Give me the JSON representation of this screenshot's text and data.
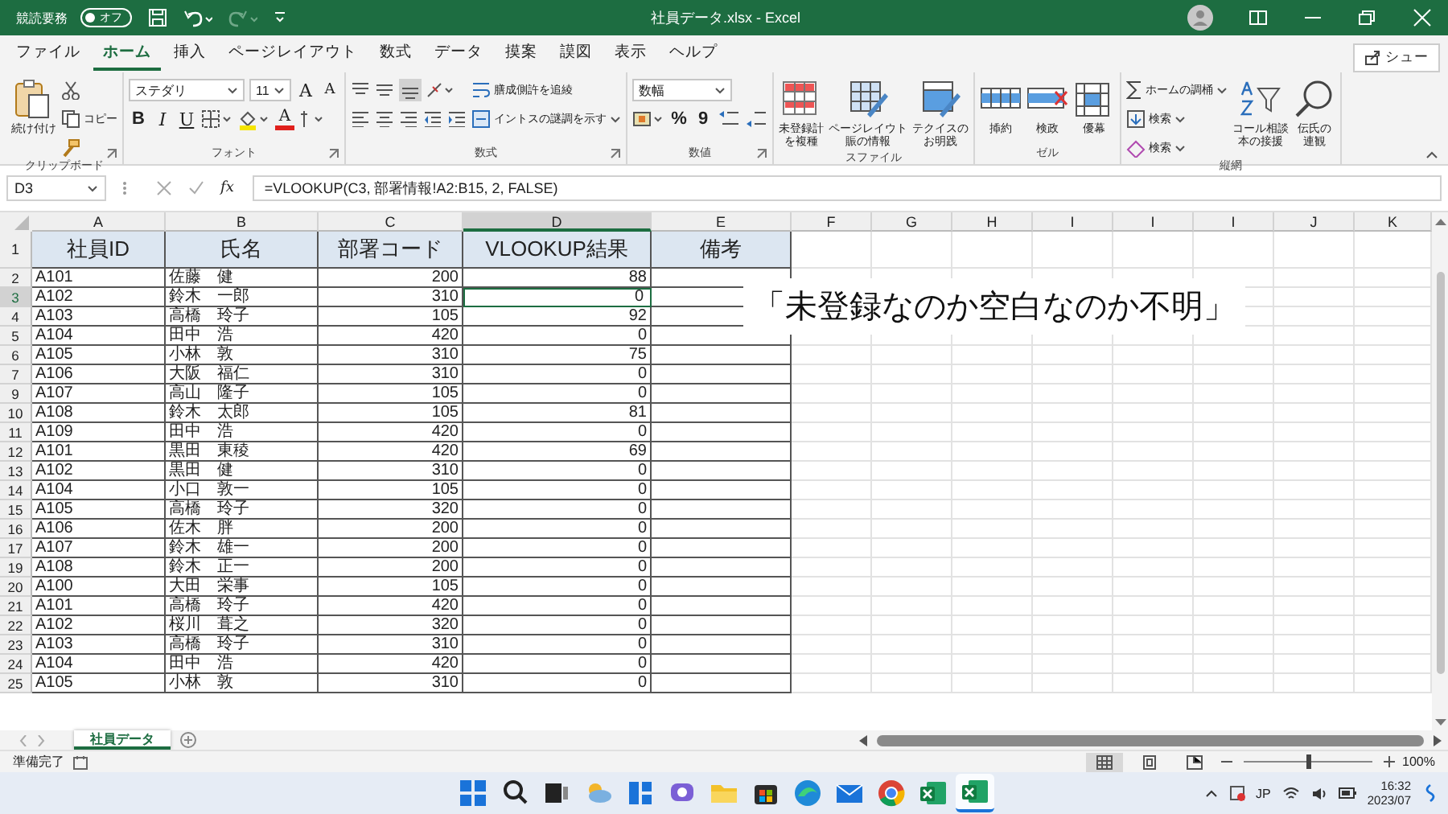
{
  "title_bar": {
    "autosave_label": "競読要務",
    "autosave_toggle": {
      "label": "オフ",
      "on": false
    },
    "title": "社員データ.xlsx  -  Excel"
  },
  "menu_tabs": [
    {
      "label": "ファイル",
      "selected": false
    },
    {
      "label": "ホーム",
      "selected": true
    },
    {
      "label": "挿入",
      "selected": false
    },
    {
      "label": "ページレイアウト",
      "selected": false
    },
    {
      "label": "数式",
      "selected": false
    },
    {
      "label": "データ",
      "selected": false
    },
    {
      "label": "摸案",
      "selected": false
    },
    {
      "label": "謨図",
      "selected": false
    },
    {
      "label": "表示",
      "selected": false
    },
    {
      "label": "ヘルプ",
      "selected": false
    }
  ],
  "share_button": "シュー",
  "ribbon": {
    "groups": [
      {
        "label": "クリップボード",
        "blocks": [
          {
            "kind": "paste",
            "lines": [
              "続け付け"
            ]
          },
          {
            "kind": "stack",
            "rows": [
              {
                "items": [
                  {
                    "kind": "cut"
                  }
                ]
              },
              {
                "items": [
                  {
                    "kind": "copy",
                    "label": "コピー"
                  }
                ]
              },
              {
                "items": [
                  {
                    "kind": "brush"
                  }
                ]
              }
            ]
          }
        ]
      },
      {
        "label": "フォント",
        "blocks": [
          {
            "kind": "stack",
            "rows": [
              {
                "items": [
                  {
                    "kind": "fontfield",
                    "value": "ステダリ"
                  },
                  {
                    "kind": "sizefield",
                    "value": "11"
                  },
                  {
                    "kind": "grow",
                    "text": "A"
                  },
                  {
                    "kind": "shrink",
                    "text": "A"
                  }
                ]
              },
              {
                "items": [
                  {
                    "kind": "glyph",
                    "text": "B"
                  },
                  {
                    "kind": "italic",
                    "text": "I"
                  },
                  {
                    "kind": "underline",
                    "text": "U"
                  },
                  {
                    "kind": "border"
                  },
                  {
                    "kind": "fill"
                  },
                  {
                    "kind": "fontcolor",
                    "text": "A"
                  },
                  {
                    "kind": "phonetic"
                  }
                ]
              }
            ]
          }
        ]
      },
      {
        "label": "数式",
        "blocks": [
          {
            "kind": "stack",
            "rows": [
              {
                "items": [
                  {
                    "kind": "aligntop"
                  },
                  {
                    "kind": "alignmid"
                  },
                  {
                    "kind": "alignbottom"
                  },
                  {
                    "kind": "orient"
                  }
                ]
              },
              {
                "items": [
                  {
                    "kind": "alignleft"
                  },
                  {
                    "kind": "aligncenter"
                  },
                  {
                    "kind": "alignright"
                  },
                  {
                    "kind": "indentdec"
                  },
                  {
                    "kind": "indentinc"
                  }
                ]
              }
            ]
          },
          {
            "kind": "stack",
            "rows": [
              {
                "items": [
                  {
                    "kind": "wrap",
                    "label": "膳成側許を追綾"
                  }
                ]
              },
              {
                "items": [
                  {
                    "kind": "merge",
                    "label": "イントスの謎調を示す"
                  }
                ]
              }
            ]
          }
        ]
      },
      {
        "label": "数値",
        "blocks": [
          {
            "kind": "stack",
            "rows": [
              {
                "items": [
                  {
                    "kind": "numfield",
                    "value": "数幅"
                  }
                ]
              },
              {
                "items": [
                  {
                    "kind": "currency"
                  },
                  {
                    "kind": "glyph",
                    "text": "%"
                  },
                  {
                    "kind": "glyph",
                    "text": "9"
                  },
                  {
                    "kind": "decinc"
                  },
                  {
                    "kind": "decdec"
                  }
                ]
              }
            ]
          }
        ]
      },
      {
        "label": "スファイル",
        "blocks": [
          {
            "kind": "condfmt",
            "lines": [
              "未登録計",
              "を複種"
            ]
          },
          {
            "kind": "tablefmt",
            "lines": [
              "ページレイウト",
              "賑の情報"
            ]
          },
          {
            "kind": "cellstyle",
            "lines": [
              "テクイスの",
              "お明践"
            ]
          }
        ]
      },
      {
        "label": "ゼル",
        "blocks": [
          {
            "kind": "insert",
            "lines": [
              "揷約"
            ]
          },
          {
            "kind": "delete",
            "lines": [
              "検政"
            ]
          },
          {
            "kind": "format",
            "lines": [
              "優幕"
            ]
          }
        ]
      },
      {
        "label": "縦網",
        "blocks": [
          {
            "kind": "stack",
            "rows": [
              {
                "items": [
                  {
                    "kind": "sum",
                    "label": "ホームの調桶"
                  }
                ]
              },
              {
                "items": [
                  {
                    "kind": "filldown",
                    "label": "検索"
                  }
                ]
              },
              {
                "items": [
                  {
                    "kind": "clear",
                    "label": "検索"
                  }
                ]
              }
            ]
          },
          {
            "kind": "sort",
            "lines": [
              "コール相談",
              "本の接援"
            ]
          },
          {
            "kind": "find",
            "lines": [
              "伝氏の",
              "連観"
            ]
          }
        ]
      }
    ]
  },
  "formula_bar": {
    "name_box": "D3",
    "fx": "fx",
    "formula": "=VLOOKUP(C3, 部署情報!A2:B15, 2, FALSE)"
  },
  "sheet": {
    "columns": [
      {
        "label": "A",
        "selected": false
      },
      {
        "label": "B",
        "selected": false
      },
      {
        "label": "C",
        "selected": false
      },
      {
        "label": "D",
        "selected": true
      },
      {
        "label": "E",
        "selected": false
      },
      {
        "label": "F",
        "selected": false
      },
      {
        "label": "G",
        "selected": false
      },
      {
        "label": "H",
        "selected": false
      },
      {
        "label": "I",
        "selected": false
      },
      {
        "label": "I",
        "selected": false
      },
      {
        "label": "I",
        "selected": false
      },
      {
        "label": "J",
        "selected": false
      },
      {
        "label": "K",
        "selected": false
      }
    ],
    "header_row": {
      "number": "1",
      "cells": [
        "社員ID",
        "氏名",
        "部署コード",
        "VLOOKUP結果",
        "備考"
      ]
    },
    "rows": [
      {
        "number": "2",
        "cells": [
          "A101",
          "佐藤　健",
          "200",
          "88"
        ],
        "selected": false
      },
      {
        "number": "3",
        "cells": [
          "A102",
          "鈴木　一郎",
          "310",
          "0"
        ],
        "selected": true
      },
      {
        "number": "4",
        "cells": [
          "A103",
          "高橋　玲子",
          "105",
          "92"
        ],
        "selected": false
      },
      {
        "number": "5",
        "cells": [
          "A104",
          "田中　浩",
          "420",
          "0"
        ],
        "selected": false
      },
      {
        "number": "6",
        "cells": [
          "A105",
          "小林　敦",
          "310",
          "75"
        ],
        "selected": false
      },
      {
        "number": "7",
        "cells": [
          "A106",
          "大阪　福仁",
          "310",
          "0"
        ],
        "selected": false
      },
      {
        "number": "9",
        "cells": [
          "A107",
          "高山　隆子",
          "105",
          "0"
        ],
        "selected": false
      },
      {
        "number": "10",
        "cells": [
          "A108",
          "鈴木　太郎",
          "105",
          "81"
        ],
        "selected": false
      },
      {
        "number": "11",
        "cells": [
          "A109",
          "田中　浩",
          "420",
          "0"
        ],
        "selected": false
      },
      {
        "number": "12",
        "cells": [
          "A101",
          "黒田　東稜",
          "420",
          "69"
        ],
        "selected": false
      },
      {
        "number": "13",
        "cells": [
          "A102",
          "黒田　健",
          "310",
          "0"
        ],
        "selected": false
      },
      {
        "number": "14",
        "cells": [
          "A104",
          "小口　敦一",
          "105",
          "0"
        ],
        "selected": false
      },
      {
        "number": "15",
        "cells": [
          "A105",
          "高橋　玲子",
          "320",
          "0"
        ],
        "selected": false
      },
      {
        "number": "16",
        "cells": [
          "A106",
          "佐木　胖",
          "200",
          "0"
        ],
        "selected": false
      },
      {
        "number": "17",
        "cells": [
          "A107",
          "鈴木　雄一",
          "200",
          "0"
        ],
        "selected": false
      },
      {
        "number": "19",
        "cells": [
          "A108",
          "鈴木　正一",
          "200",
          "0"
        ],
        "selected": false
      },
      {
        "number": "20",
        "cells": [
          "A100",
          "大田　栄事",
          "105",
          "0"
        ],
        "selected": false
      },
      {
        "number": "21",
        "cells": [
          "A101",
          "高橋　玲子",
          "420",
          "0"
        ],
        "selected": false
      },
      {
        "number": "22",
        "cells": [
          "A102",
          "桜川　葺之",
          "320",
          "0"
        ],
        "selected": false
      },
      {
        "number": "23",
        "cells": [
          "A103",
          "高橋　玲子",
          "310",
          "0"
        ],
        "selected": false
      },
      {
        "number": "24",
        "cells": [
          "A104",
          "田中　浩",
          "420",
          "0"
        ],
        "selected": false
      },
      {
        "number": "25",
        "cells": [
          "A105",
          "小林　敦",
          "310",
          "0"
        ],
        "selected": false
      }
    ]
  },
  "callout": "「未登録なのか空白なのか不明」",
  "sheet_tabs": [
    {
      "label": "社員データ",
      "selected": true
    }
  ],
  "status_bar": {
    "status": "準備完了",
    "views": [
      {
        "kind": "normal",
        "selected": true
      },
      {
        "kind": "layout",
        "selected": false
      },
      {
        "kind": "pagebreak",
        "selected": false
      }
    ],
    "zoom": {
      "level": 0.5,
      "reading": "100%"
    }
  },
  "taskbar": {
    "apps": [
      {
        "kind": "start",
        "active": false
      },
      {
        "kind": "search",
        "active": false
      },
      {
        "kind": "taskview",
        "active": false
      },
      {
        "kind": "widgets",
        "active": false
      },
      {
        "kind": "snap",
        "active": false
      },
      {
        "kind": "chat",
        "active": false
      },
      {
        "kind": "folder",
        "active": false
      },
      {
        "kind": "store",
        "active": false
      },
      {
        "kind": "edge",
        "active": false
      },
      {
        "kind": "mail",
        "active": false
      },
      {
        "kind": "chrome",
        "active": false
      },
      {
        "kind": "excel",
        "active": false
      },
      {
        "kind": "excel",
        "active": true
      }
    ],
    "language": "JP",
    "time": "16:32",
    "date": "2023/07"
  }
}
